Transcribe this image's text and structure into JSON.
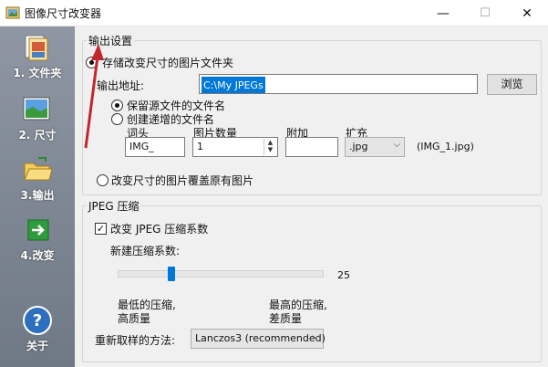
{
  "window": {
    "title": "图像尺寸改变器",
    "controls": {
      "minimize": "—",
      "maximize": "☐",
      "close": "✕"
    }
  },
  "sidebar": {
    "items": [
      {
        "label": "1. 文件夹",
        "icon": "folder-images-icon"
      },
      {
        "label": "2. 尺寸",
        "icon": "resize-picture-icon"
      },
      {
        "label": "3.输出",
        "icon": "output-folder-icon"
      },
      {
        "label": "4.改变",
        "icon": "green-arrow-icon"
      }
    ],
    "about": {
      "label": "关于",
      "icon": "help-icon"
    }
  },
  "output": {
    "group_title": "输出设置",
    "option_store_folder": "存储改变尺寸的图片文件夹",
    "address_label": "输出地址:",
    "address_value": "C:\\My JPEGs",
    "browse_button": "浏览",
    "option_keep_name": "保留源文件的文件名",
    "option_create_name": "创建递增的文件名",
    "prefix_label": "词头",
    "prefix_value": "IMG_",
    "count_label": "图片数量",
    "count_value": "1",
    "suffix_label": "附加",
    "suffix_value": "",
    "ext_label": "扩充",
    "ext_value": ".jpg",
    "example": "(IMG_1.jpg)",
    "option_overwrite": "改变尺寸的图片覆盖原有图片"
  },
  "jpeg": {
    "group_title": "JPEG 压缩",
    "change_checkbox": "改变 JPEG 压缩系数",
    "change_checked": true,
    "new_label": "新建压缩系数:",
    "slider_value": 25,
    "slider_value_text": "25",
    "low_label_1": "最低的压缩,",
    "low_label_2": "高质量",
    "high_label_1": "最高的压缩,",
    "high_label_2": "差质量"
  },
  "resample": {
    "label": "重新取样的方法:",
    "value": "Lanczos3 (recommended)"
  },
  "colors": {
    "sidebar_top": "#8e97a3",
    "sidebar_bottom": "#6f7885",
    "selection": "#0078d7",
    "slider_thumb": "#0078d7",
    "annotation_arrow": "#c0282d"
  }
}
